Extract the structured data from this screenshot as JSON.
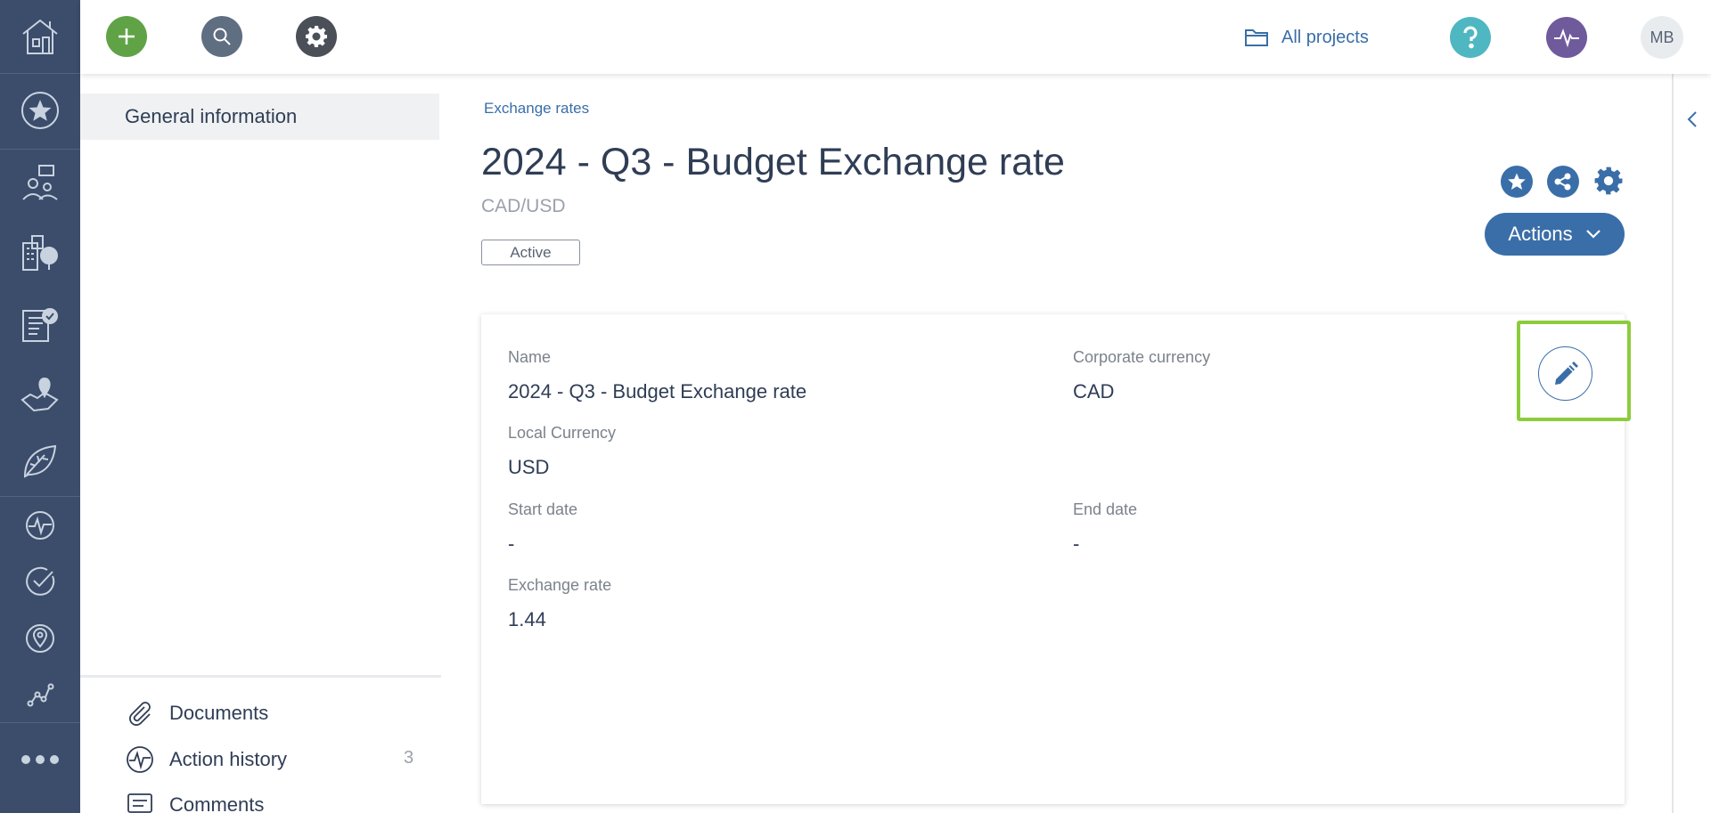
{
  "topbar": {
    "all_projects_label": "All projects",
    "avatar_initials": "MB"
  },
  "sidenav": {
    "general_info_label": "General information",
    "documents_label": "Documents",
    "action_history_label": "Action history",
    "action_history_count": "3",
    "comments_label": "Comments"
  },
  "breadcrumb": {
    "label": "Exchange rates"
  },
  "header": {
    "title": "2024 - Q3 - Budget Exchange rate",
    "subtitle": "CAD/USD",
    "status": "Active",
    "actions_label": "Actions"
  },
  "details": {
    "name_label": "Name",
    "name_value": "2024 - Q3 - Budget Exchange rate",
    "corporate_currency_label": "Corporate currency",
    "corporate_currency_value": "CAD",
    "local_currency_label": "Local Currency",
    "local_currency_value": "USD",
    "start_date_label": "Start date",
    "start_date_value": "-",
    "end_date_label": "End date",
    "end_date_value": "-",
    "exchange_rate_label": "Exchange rate",
    "exchange_rate_value": "1.44"
  },
  "colors": {
    "rail_bg": "#3b4d6b",
    "accent_blue": "#3a6ea8",
    "add_green": "#5fa346",
    "help_teal": "#4fb7c1",
    "activity_purple": "#6f5a9c",
    "highlight_green": "#8ccc3c"
  },
  "icons": {
    "rail": [
      "home-icon",
      "star-icon",
      "people-comment-icon",
      "buildings-icon",
      "clipboard-check-icon",
      "map-pin-region-icon",
      "leaf-icon",
      "pulse-icon",
      "check-circle-icon",
      "location-icon",
      "trend-icon",
      "more-icon"
    ],
    "topbar": [
      "plus-icon",
      "search-icon",
      "gear-icon",
      "folder-icon",
      "question-icon",
      "pulse-icon"
    ],
    "header": [
      "star-icon",
      "share-icon",
      "gear-icon",
      "chevron-down-icon"
    ],
    "card": [
      "pencil-icon"
    ]
  }
}
